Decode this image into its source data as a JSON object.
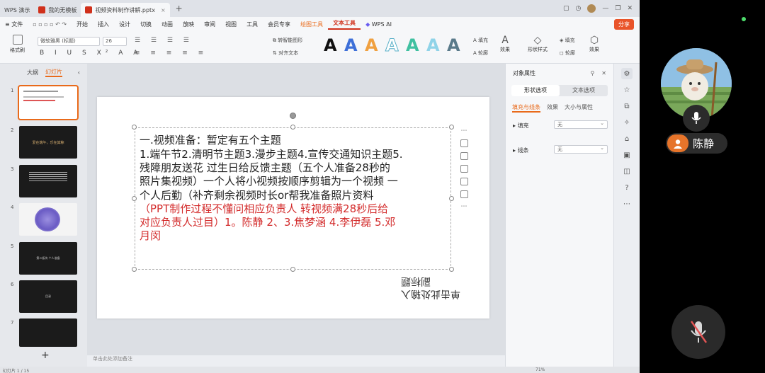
{
  "titlebar": {
    "tabs": [
      {
        "label": "WPS 演示",
        "color": "#2a5fc1"
      },
      {
        "label": "我的无模板",
        "color": "#d0301b"
      },
      {
        "label": "视频资料制作讲解.pptx",
        "color": "#d0301b"
      }
    ],
    "new_tab": "+"
  },
  "menubar": {
    "file": "文件",
    "items": [
      "开始",
      "插入",
      "设计",
      "切换",
      "动画",
      "放映",
      "审阅",
      "视图",
      "工具",
      "会员专享"
    ],
    "drawing_tools": "绘图工具",
    "text_tools": "文本工具",
    "wps_ai": "WPS AI",
    "share": "分享"
  },
  "ribbon": {
    "format_painter": "格式刷",
    "font_name": "微软雅黑 (标题)",
    "font_size": "26",
    "convert_smartart": "转智能图形",
    "text_direction": "对齐文本",
    "fill_label": "填充",
    "outline_label": "轮廓",
    "effects_label": "效果",
    "shape_style": "形状样式",
    "shape_fill": "填充",
    "shape_outline": "轮廓",
    "shape_effects": "效果"
  },
  "left_panel": {
    "tab_outline": "大纲",
    "tab_slides": "幻灯片",
    "slides": [
      {
        "num": "1",
        "text": ""
      },
      {
        "num": "2",
        "text": "爱在端午，乐在其粽"
      },
      {
        "num": "3",
        "text": ""
      },
      {
        "num": "4",
        "text": ""
      },
      {
        "num": "5",
        "text": "第二板块 个人准备"
      },
      {
        "num": "6",
        "text": "目录"
      },
      {
        "num": "7",
        "text": ""
      }
    ],
    "add_slide": "+"
  },
  "slide": {
    "lines": [
      "一.视频准备：暂定有五个主题",
      "1.端午节2.清明节主题3.漫步主题4.宣传交通知识主题5.",
      "残障朋友送花 过生日给反馈主题（五个人准备28秒的",
      "照片集视频）一个人将小视频按顺序剪辑为一个视频 一",
      "个人后勤（补齐剩余视频时长or帮我准备照片资料"
    ],
    "red_lines": [
      "（PPT制作过程不懂问相应负责人   转视频满28秒后给",
      "对应负责人过目）1。陈静 2、3.焦梦涵 4.李伊磊 5.邓",
      "月闵"
    ],
    "mirrored_placeholder": [
      "单击此处输入",
      "副标题"
    ],
    "notes_hint": "单击此处添加备注"
  },
  "property_panel": {
    "title": "对象属性",
    "tab_shape": "形状选项",
    "tab_text": "文本选项",
    "sub_fill_line": "填充与线条",
    "sub_effects": "效果",
    "sub_size": "大小与属性",
    "fill_label": "填充",
    "fill_value": "无",
    "line_label": "线条",
    "line_value": "无"
  },
  "statusbar": {
    "left": "幻灯片 1 / 15",
    "right": "71%"
  },
  "video": {
    "participant_name": "陈静"
  }
}
